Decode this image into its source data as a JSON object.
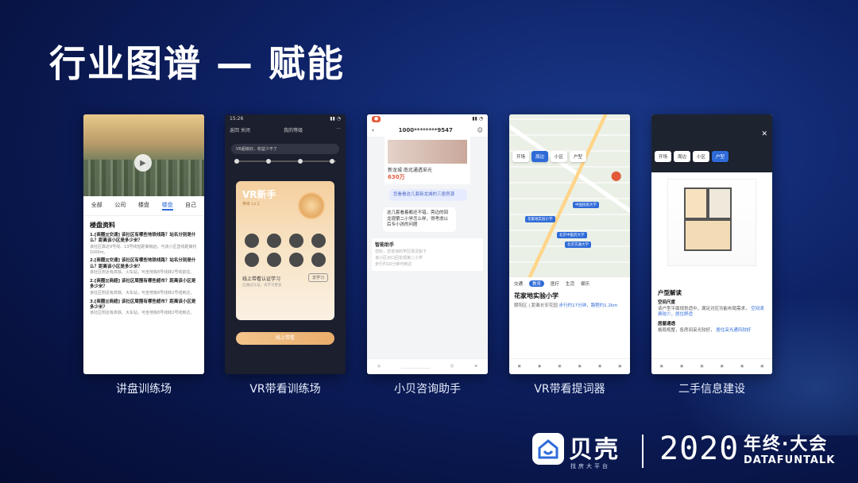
{
  "slide": {
    "title": "行业图谱 — 赋能"
  },
  "phones": [
    {
      "caption": "讲盘训练场",
      "tabs": [
        "全部",
        "公司",
        "楼盘",
        "楼盘",
        "自己"
      ],
      "section_title": "楼盘资料",
      "qa": [
        {
          "q": "1.[商圈][交通] 该社区有哪些地铁线路？站名分别是什么？距离该小区是多少米？",
          "a": "该社区靠近9号线、13号线但距离稍远，与该小区直线距离约1000m。"
        },
        {
          "q": "2.[商圈][交通] 该社区有哪些地铁线路？站名分别是什么？距离该小区是多少米？",
          "a": "该社区附近有高铁、火车站，可坐地铁8号线转2号线前往。"
        },
        {
          "q": "2.[商圈][商超] 该社区周围有哪些超市？距离该小区是多少米？",
          "a": "该社区附近有高铁、大车站，可坐地铁8号线转2号线到达。"
        },
        {
          "q": "3.[商圈][商超] 该社区周围有哪些超市？距离该小区是多少米？",
          "a": "该社区附近有高铁、大车站，可坐地铁8号线转2号线到达。"
        }
      ]
    },
    {
      "caption": "VR带看训练场",
      "time": "15:26",
      "back": "返回 关闭",
      "header": "我的等级",
      "toast": "VR超级好，收益少不了",
      "badge": "VR新手",
      "badge_sub": "等级 Lv.1",
      "line1": "线上带看认证学习",
      "line2": "已通过认证，去学习更多",
      "btn": "去学习",
      "cta": "线上带看"
    },
    {
      "caption": "小贝咨询助手",
      "phone_no": "1000********9547",
      "listing": "新龙城 南北通透采光",
      "price": "630万",
      "msg_right": "您看看这几套新龙城的三居房源",
      "msg_left": "这几套看着都还不错，旁边的回龙观第二小学怎么样，得考虑以后专小孩的问题",
      "assist_title": "智能助手",
      "assist_lines": [
        "您好，您咨询的学区情况如下",
        "该小区对口回龙观第二小学",
        "步行约10分钟可到达"
      ]
    },
    {
      "caption": "VR带看提词器",
      "chips": [
        "开场",
        "周边",
        "小区",
        "户型"
      ],
      "tabs": [
        "交通",
        "教育",
        "医疗",
        "生活",
        "娱乐"
      ],
      "school": "花家地实验小学",
      "sub_prefix": "朝阳区 | 距离长安花园",
      "sub_dist": "步行约17分钟，路程约1.2km",
      "pins": [
        "中国民航大学",
        "花家地实验小学",
        "北京中医药大学",
        "北京交通大学"
      ]
    },
    {
      "caption": "二手信息建设",
      "chips": [
        "开场",
        "周边",
        "小区",
        "户型"
      ],
      "section_title": "户型解读",
      "items": [
        {
          "h": "空间尺度",
          "t": "该户型平面规划适中，满足对应功能布局需求，",
          "link": "空间浪费较少，居住舒适"
        },
        {
          "h": "居屋通透",
          "t": "格局规整，各房间采光较好，",
          "link": "居住采光通风较好"
        }
      ]
    }
  ],
  "footer": {
    "brand": "贝壳",
    "brand_sub": "找房大平台",
    "year": "2020",
    "yearend": "年终·大会",
    "event": "DATAFUNTALK"
  },
  "colors": {
    "accent": "#2f6bd8",
    "bg": "#0e2266"
  }
}
